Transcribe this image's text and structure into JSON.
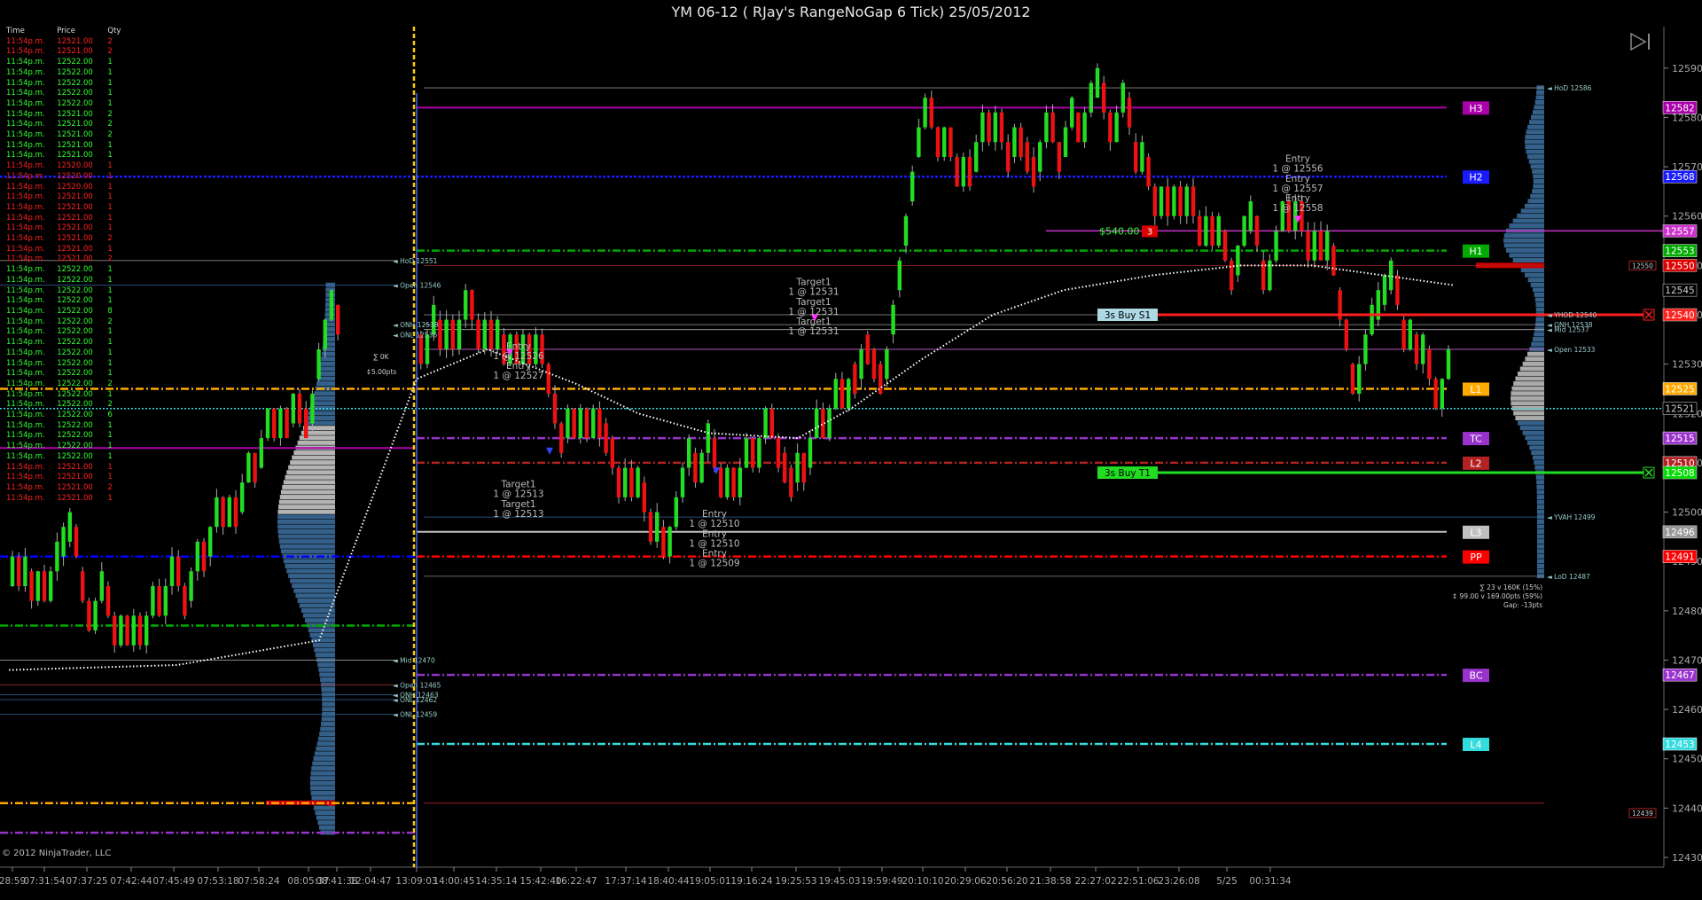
{
  "window": {
    "title": "YM 06-12 ( RJay's RangeNoGap  6 Tick)  25/05/2012",
    "copyright": "© 2012 NinjaTrader, LLC"
  },
  "tape": {
    "headers": [
      "Time",
      "Price",
      "Qty"
    ],
    "rows": [
      [
        "11:54p.m.",
        "12521.00",
        "2",
        "down"
      ],
      [
        "11:54p.m.",
        "12521.00",
        "2",
        "down"
      ],
      [
        "11:54p.m.",
        "12522.00",
        "1",
        "up"
      ],
      [
        "11:54p.m.",
        "12522.00",
        "1",
        "up"
      ],
      [
        "11:54p.m.",
        "12522.00",
        "1",
        "up"
      ],
      [
        "11:54p.m.",
        "12522.00",
        "1",
        "up"
      ],
      [
        "11:54p.m.",
        "12522.00",
        "1",
        "up"
      ],
      [
        "11:54p.m.",
        "12521.00",
        "2",
        "up"
      ],
      [
        "11:54p.m.",
        "12521.00",
        "2",
        "up"
      ],
      [
        "11:54p.m.",
        "12521.00",
        "2",
        "up"
      ],
      [
        "11:54p.m.",
        "12521.00",
        "1",
        "up"
      ],
      [
        "11:54p.m.",
        "12521.00",
        "1",
        "up"
      ],
      [
        "11:54p.m.",
        "12520.00",
        "1",
        "down"
      ],
      [
        "11:54p.m.",
        "12520.00",
        "1",
        "down"
      ],
      [
        "11:54p.m.",
        "12520.00",
        "1",
        "down"
      ],
      [
        "11:54p.m.",
        "12521.00",
        "1",
        "down"
      ],
      [
        "11:54p.m.",
        "12521.00",
        "1",
        "down"
      ],
      [
        "11:54p.m.",
        "12521.00",
        "1",
        "down"
      ],
      [
        "11:54p.m.",
        "12521.00",
        "1",
        "down"
      ],
      [
        "11:54p.m.",
        "12521.00",
        "2",
        "down"
      ],
      [
        "11:54p.m.",
        "12521.00",
        "1",
        "down"
      ],
      [
        "11:54p.m.",
        "12521.00",
        "2",
        "down"
      ],
      [
        "11:54p.m.",
        "12522.00",
        "1",
        "up"
      ],
      [
        "11:54p.m.",
        "12522.00",
        "1",
        "up"
      ],
      [
        "11:54p.m.",
        "12522.00",
        "1",
        "up"
      ],
      [
        "11:54p.m.",
        "12522.00",
        "1",
        "up"
      ],
      [
        "11:54p.m.",
        "12522.00",
        "8",
        "up"
      ],
      [
        "11:54p.m.",
        "12522.00",
        "2",
        "up"
      ],
      [
        "11:54p.m.",
        "12522.00",
        "1",
        "up"
      ],
      [
        "11:54p.m.",
        "12522.00",
        "1",
        "up"
      ],
      [
        "11:54p.m.",
        "12522.00",
        "1",
        "up"
      ],
      [
        "11:54p.m.",
        "12522.00",
        "1",
        "up"
      ],
      [
        "11:54p.m.",
        "12522.00",
        "1",
        "up"
      ],
      [
        "11:54p.m.",
        "12522.00",
        "2",
        "up"
      ],
      [
        "11:54p.m.",
        "12522.00",
        "1",
        "up"
      ],
      [
        "11:54p.m.",
        "12522.00",
        "2",
        "up"
      ],
      [
        "11:54p.m.",
        "12522.00",
        "6",
        "up"
      ],
      [
        "11:54p.m.",
        "12522.00",
        "1",
        "up"
      ],
      [
        "11:54p.m.",
        "12522.00",
        "1",
        "up"
      ],
      [
        "11:54p.m.",
        "12522.00",
        "1",
        "up"
      ],
      [
        "11:54p.m.",
        "12522.00",
        "1",
        "up"
      ],
      [
        "11:54p.m.",
        "12521.00",
        "1",
        "down"
      ],
      [
        "11:54p.m.",
        "12521.00",
        "1",
        "down"
      ],
      [
        "11:54p.m.",
        "12521.00",
        "2",
        "down"
      ],
      [
        "11:54p.m.",
        "12521.00",
        "1",
        "down"
      ]
    ],
    "up_color": "#33ff33",
    "down_color": "#ff2020"
  },
  "chart_data": {
    "type": "candlestick",
    "title": "YM 06-12 ( RJay's RangeNoGap  6 Tick)  25/05/2012",
    "ylim": [
      12430,
      12595
    ],
    "yticks": [
      12590,
      12580,
      12570,
      12560,
      12550,
      12540,
      12530,
      12520,
      12510,
      12500,
      12490,
      12480,
      12470,
      12460,
      12450,
      12440,
      12430
    ],
    "xticks": [
      "28:59",
      "07:31:54",
      "07:37:25",
      "07:42:44",
      "07:45:49",
      "07:53:18",
      "07:58:24",
      "08:05:37",
      "08:41:38",
      "12:04:47",
      "13:09:03",
      "14:00:45",
      "14:35:14",
      "15:42:40",
      "16:22:47",
      "17:37:14",
      "18:40:44",
      "19:05:01",
      "19:16:24",
      "19:25:53",
      "19:45:03",
      "19:59:49",
      "20:10:10",
      "20:29:06",
      "20:56:20",
      "21:38:58",
      "22:27:02",
      "22:51:06",
      "23:26:08",
      "5/25",
      "00:31:34"
    ],
    "pivot_levels": [
      {
        "name": "H3",
        "value": 12582,
        "color": "#aa00aa",
        "tag": "12582"
      },
      {
        "name": "H2",
        "value": 12568,
        "color": "#1a1aff",
        "tag": "12568"
      },
      {
        "name": "H1",
        "value": 12553,
        "color": "#00aa00",
        "tag": "12553"
      },
      {
        "name": "L1",
        "value": 12525,
        "color": "#ffaa00",
        "tag": "12525"
      },
      {
        "name": "TC",
        "value": 12515,
        "color": "#9933cc",
        "tag": "12515"
      },
      {
        "name": "L2",
        "value": 12510,
        "color": "#b22222",
        "tag": "12510"
      },
      {
        "name": "L3",
        "value": 12496,
        "color": "#c0c0c0",
        "tag": "12496"
      },
      {
        "name": "PP",
        "value": 12491,
        "color": "#ff0000",
        "tag": "12491"
      },
      {
        "name": "BC",
        "value": 12467,
        "color": "#9933cc",
        "tag": "12467"
      },
      {
        "name": "L4",
        "value": 12453,
        "color": "#33dddd",
        "tag": "12453"
      }
    ],
    "other_price_tags": [
      {
        "value": 12557,
        "color": "#cc33cc",
        "label": "12557"
      },
      {
        "value": 12550,
        "color": "#dd0000",
        "label": "12550"
      },
      {
        "value": 12545,
        "color": "#000",
        "label": "12545"
      },
      {
        "value": 12540,
        "color": "#ff2020",
        "label": "12540"
      },
      {
        "value": 12521,
        "color": "#000",
        "label": "12521"
      },
      {
        "value": 12508,
        "color": "#00dd00",
        "label": "12508"
      },
      {
        "value": 12496,
        "color": "#999",
        "label": "12496"
      }
    ],
    "right_labels": [
      {
        "value": 12586,
        "text": "HoD 12586"
      },
      {
        "value": 12540,
        "text": "YHOD 12540"
      },
      {
        "value": 12538,
        "text": "ONH 12538"
      },
      {
        "value": 12537,
        "text": "Mid 12537"
      },
      {
        "value": 12533,
        "text": "Open 12533"
      },
      {
        "value": 12499,
        "text": "YVAH 12499"
      },
      {
        "value": 12487,
        "text": "LoD 12487"
      }
    ],
    "left_labels": [
      {
        "value": 12551,
        "text": "HoD 12551"
      },
      {
        "value": 12546,
        "text": "Open 12546"
      },
      {
        "value": 12538,
        "text": "ONH 12538"
      },
      {
        "value": 12536,
        "text": "ONL 12536"
      },
      {
        "value": 12470,
        "text": "Mid 12470"
      },
      {
        "value": 12465,
        "text": "Open 12465"
      },
      {
        "value": 12463,
        "text": "ONH 12463"
      },
      {
        "value": 12462,
        "text": "ONL 12462"
      },
      {
        "value": 12459,
        "text": "ONL 12459"
      }
    ],
    "orders": [
      {
        "text": "3s  Buy S1",
        "value": 12540,
        "color": "#ff2020",
        "label_bg": "#add8e6"
      },
      {
        "text": "3s  Buy T1",
        "value": 12508,
        "color": "#22dd22",
        "label_bg": "#22dd22"
      }
    ],
    "pnl": {
      "text": "$540.00",
      "qty": "3",
      "value": 12557
    },
    "annotations": [
      {
        "text": "Entry",
        "sub": "1 @ 12526",
        "x": "13:09:03",
        "value": 12533
      },
      {
        "text": "Entry",
        "sub": "1 @ 12527",
        "x": "13:09:03",
        "value": 12529
      },
      {
        "text": "Target1",
        "sub": "1 @ 12531",
        "x": "18:40:44",
        "value": 12546
      },
      {
        "text": "Target1",
        "sub": "1 @ 12531",
        "x": "18:40:44",
        "value": 12542
      },
      {
        "text": "Target1",
        "sub": "1 @ 12531",
        "x": "18:40:44",
        "value": 12538
      },
      {
        "text": "Target1",
        "sub": "1 @ 12513",
        "x": "13:09:03",
        "value": 12505
      },
      {
        "text": "Target1",
        "sub": "1 @ 12513",
        "x": "13:09:03",
        "value": 12501
      },
      {
        "text": "Entry",
        "sub": "1 @ 12510",
        "x": "15:42:40",
        "value": 12499
      },
      {
        "text": "Entry",
        "sub": "1 @ 12510",
        "x": "15:42:40",
        "value": 12495
      },
      {
        "text": "Entry",
        "sub": "1 @ 12509",
        "x": "15:42:40",
        "value": 12491
      },
      {
        "text": "Entry",
        "sub": "1 @ 12556",
        "x": "22:27:02",
        "value": 12571
      },
      {
        "text": "Entry",
        "sub": "1 @ 12557",
        "x": "22:27:02",
        "value": 12567
      },
      {
        "text": "Entry",
        "sub": "1 @ 12558",
        "x": "22:27:02",
        "value": 12563
      }
    ],
    "stats": [
      "∑ 23 v 160K (15%)",
      "↕ 99.00 v 169.00pts (59%)",
      "Gap: -13pts"
    ],
    "left_stats": [
      "∑ 0K",
      "↕5.00pts"
    ]
  }
}
